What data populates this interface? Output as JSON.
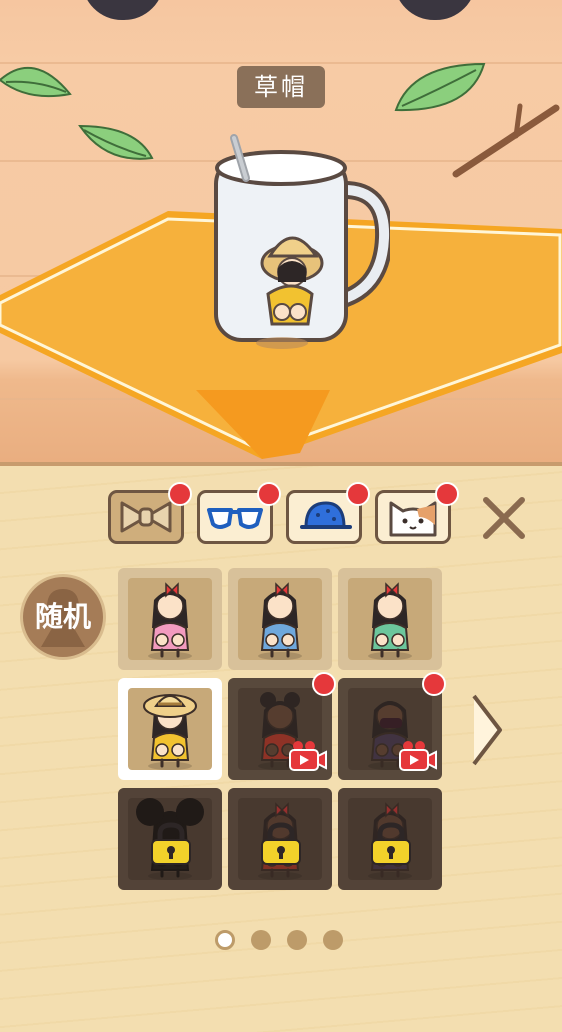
{
  "scene": {
    "title": "草帽"
  },
  "categories": [
    {
      "name": "ribbon",
      "icon": "bow-icon",
      "active": true,
      "notify": true
    },
    {
      "name": "glasses",
      "icon": "glasses-icon",
      "active": false,
      "notify": true
    },
    {
      "name": "hat",
      "icon": "cap-icon",
      "active": false,
      "notify": true
    },
    {
      "name": "pet",
      "icon": "cat-face-icon",
      "active": false,
      "notify": true
    }
  ],
  "random_label": "随机",
  "outfits": [
    {
      "dress": "#f29bbf",
      "state": "unlocked",
      "hat": "bow",
      "skin": "light"
    },
    {
      "dress": "#6fa8dc",
      "state": "unlocked",
      "hat": "bow",
      "skin": "light"
    },
    {
      "dress": "#6cc69c",
      "state": "unlocked",
      "hat": "bow",
      "skin": "light"
    },
    {
      "dress": "#f2c230",
      "state": "selected",
      "hat": "straw",
      "skin": "light"
    },
    {
      "dress": "#c0392b",
      "state": "video",
      "hat": "buns",
      "skin": "dark"
    },
    {
      "dress": "#4a3b55",
      "state": "video",
      "hat": "mask",
      "skin": "dark"
    },
    {
      "dress": "#1a1a1a",
      "state": "locked",
      "hat": "mouse",
      "skin": "silhouette"
    },
    {
      "dress": "#c0392b",
      "state": "locked",
      "hat": "bow",
      "skin": "dark"
    },
    {
      "dress": "#4a3b55",
      "state": "locked",
      "hat": "bow",
      "skin": "dark"
    }
  ],
  "pagination": {
    "current": 1,
    "total": 4
  },
  "colors": {
    "accent": "#e5383b",
    "wood": "#f6c9a2",
    "panel": "#f3deb0",
    "tab_border": "#6e5642"
  }
}
